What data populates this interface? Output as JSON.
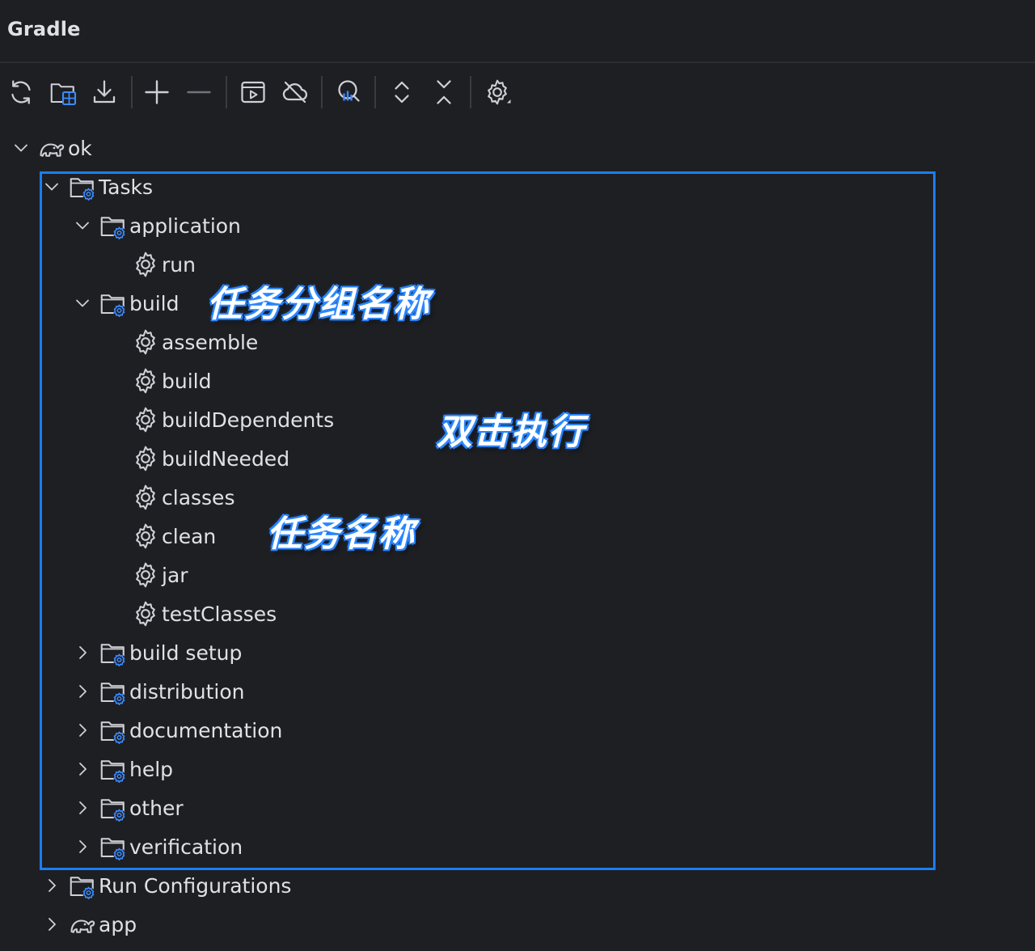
{
  "window": {
    "title": "Gradle"
  },
  "toolbar": {
    "buttons": [
      {
        "icon": "refresh-icon"
      },
      {
        "icon": "link-project-icon"
      },
      {
        "icon": "download-sources-icon"
      },
      {
        "icon": "add-icon"
      },
      {
        "icon": "remove-icon"
      },
      {
        "icon": "execute-task-icon"
      },
      {
        "icon": "offline-mode-icon"
      },
      {
        "icon": "analyze-dependencies-icon"
      },
      {
        "icon": "expand-all-icon"
      },
      {
        "icon": "collapse-all-icon"
      },
      {
        "icon": "settings-icon"
      }
    ]
  },
  "tree": {
    "root": {
      "label": "ok",
      "icon": "gradle-elephant-icon",
      "expanded": true
    },
    "tasks": {
      "label": "Tasks",
      "expanded": true
    },
    "groups": {
      "application": {
        "label": "application",
        "tasks": [
          "run"
        ]
      },
      "build": {
        "label": "build",
        "tasks": [
          "assemble",
          "build",
          "buildDependents",
          "buildNeeded",
          "classes",
          "clean",
          "jar",
          "testClasses"
        ]
      },
      "collapsed": [
        "build setup",
        "distribution",
        "documentation",
        "help",
        "other",
        "verification"
      ]
    },
    "run_configurations": {
      "label": "Run Configurations"
    },
    "app": {
      "label": "app",
      "icon": "gradle-elephant-icon"
    }
  },
  "annotations": {
    "group_name": "任务分组名称",
    "double_click": "双击执行",
    "task_name": "任务名称"
  },
  "colors": {
    "background": "#1e1f22",
    "text": "#dfe1e5",
    "icon": "#ced0d6",
    "accent_blue": "#1a7cff",
    "icon_gear_blue": "#3d8bff"
  }
}
